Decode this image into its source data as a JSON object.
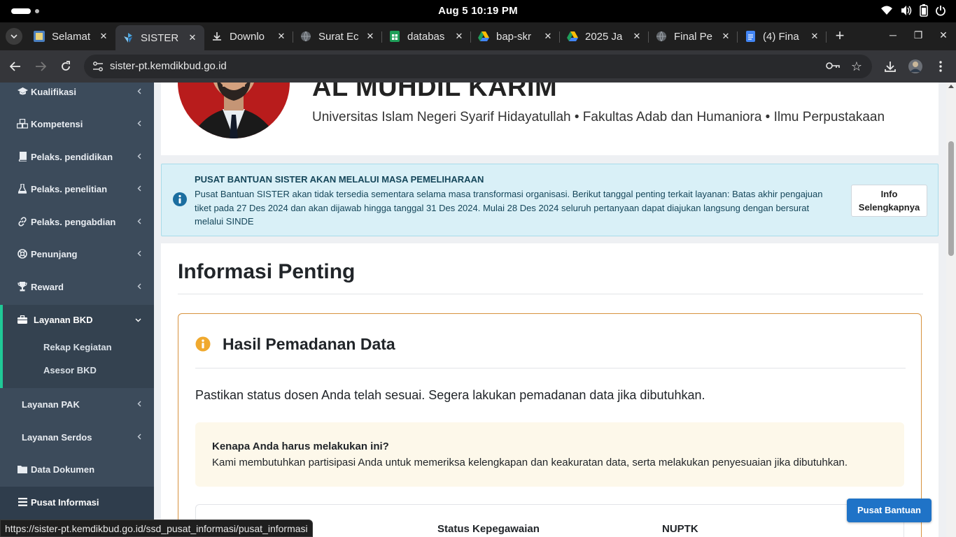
{
  "os": {
    "clock": "Aug 5  10:19 PM"
  },
  "browser": {
    "tabs": [
      {
        "label": "Selamat",
        "icon": "site-favicon"
      },
      {
        "label": "SISTER",
        "icon": "sister-favicon"
      },
      {
        "label": "Downlo",
        "icon": "download-icon"
      },
      {
        "label": "Surat Ec",
        "icon": "globe-icon"
      },
      {
        "label": "databas",
        "icon": "sheets-icon"
      },
      {
        "label": "bap-skr",
        "icon": "drive-icon"
      },
      {
        "label": "2025 Ja",
        "icon": "drive-icon"
      },
      {
        "label": "Final Pe",
        "icon": "globe-icon"
      },
      {
        "label": "(4) Fina",
        "icon": "docs-icon"
      }
    ],
    "active_tab_index": 1,
    "close_glyph": "✕",
    "new_tab_glyph": "+",
    "url": "sister-pt.kemdikbud.go.id",
    "status_url": "https://sister-pt.kemdikbud.go.id/ssd_pusat_informasi/pusat_informasi"
  },
  "sidebar": {
    "items": [
      {
        "label": "Kualifikasi",
        "icon": "graduation-cap-icon",
        "expandable": true
      },
      {
        "label": "Kompetensi",
        "icon": "cubes-icon",
        "expandable": true
      },
      {
        "label": "Pelaks. pendidikan",
        "icon": "book-icon",
        "expandable": true
      },
      {
        "label": "Pelaks. penelitian",
        "icon": "flask-icon",
        "expandable": true
      },
      {
        "label": "Pelaks. pengabdian",
        "icon": "link-icon",
        "expandable": true
      },
      {
        "label": "Penunjang",
        "icon": "life-ring-icon",
        "expandable": true
      },
      {
        "label": "Reward",
        "icon": "trophy-icon",
        "expandable": true
      },
      {
        "label": "Layanan BKD",
        "icon": "briefcase-icon",
        "expandable": true,
        "expanded": true
      },
      {
        "label": "Layanan PAK",
        "icon": "",
        "expandable": true
      },
      {
        "label": "Layanan Serdos",
        "icon": "",
        "expandable": true
      },
      {
        "label": "Data Dokumen",
        "icon": "folder-icon",
        "expandable": false
      },
      {
        "label": "Pusat Informasi",
        "icon": "list-icon",
        "expandable": false
      }
    ],
    "bkd_subitems": [
      "Rekap Kegiatan",
      "Asesor BKD"
    ],
    "colors": {
      "background": "#3c4b5b",
      "active_accent": "#20c997"
    }
  },
  "profile": {
    "name": "AL MUHDIL KARIM",
    "affiliation": "Universitas Islam Negeri Syarif Hidayatullah • Fakultas Adab dan Humaniora • Ilmu Perpustakaan"
  },
  "notice": {
    "title": "PUSAT BANTUAN SISTER AKAN MELALUI MASA PEMELIHARAAN",
    "body": "Pusat Bantuan SISTER akan tidak tersedia sementara selama masa transformasi organisasi. Berikut tanggal penting terkait layanan: Batas akhir pengajuan tiket pada 27 Des 2024 dan akan dijawab hingga tanggal 31 Des 2024. Mulai 28 Des 2024 seluruh pertanyaan dapat diajukan langsung dengan bersurat melalui SINDE",
    "button_label": "Info Selengkapnya",
    "color": "#d9f0f7"
  },
  "info": {
    "title": "Informasi Penting",
    "card": {
      "title": "Hasil Pemadanan Data",
      "description": "Pastikan status dosen Anda telah sesuai. Segera lakukan pemadanan data jika dibutuhkan.",
      "why_title": "Kenapa Anda harus melakukan ini?",
      "why_text": "Kami membutuhkan partisipasi Anda untuk memeriksa kelengkapan dan keakuratan data, serta melakukan penyesuaian jika dibutuhkan.",
      "table_headers": [
        "Status Kepegawaian",
        "NUPTK"
      ],
      "border_color": "#d7923d",
      "icon_color": "#f0a92e"
    }
  },
  "help_button": {
    "label": "Pusat Bantuan",
    "color": "#1f73c7"
  }
}
